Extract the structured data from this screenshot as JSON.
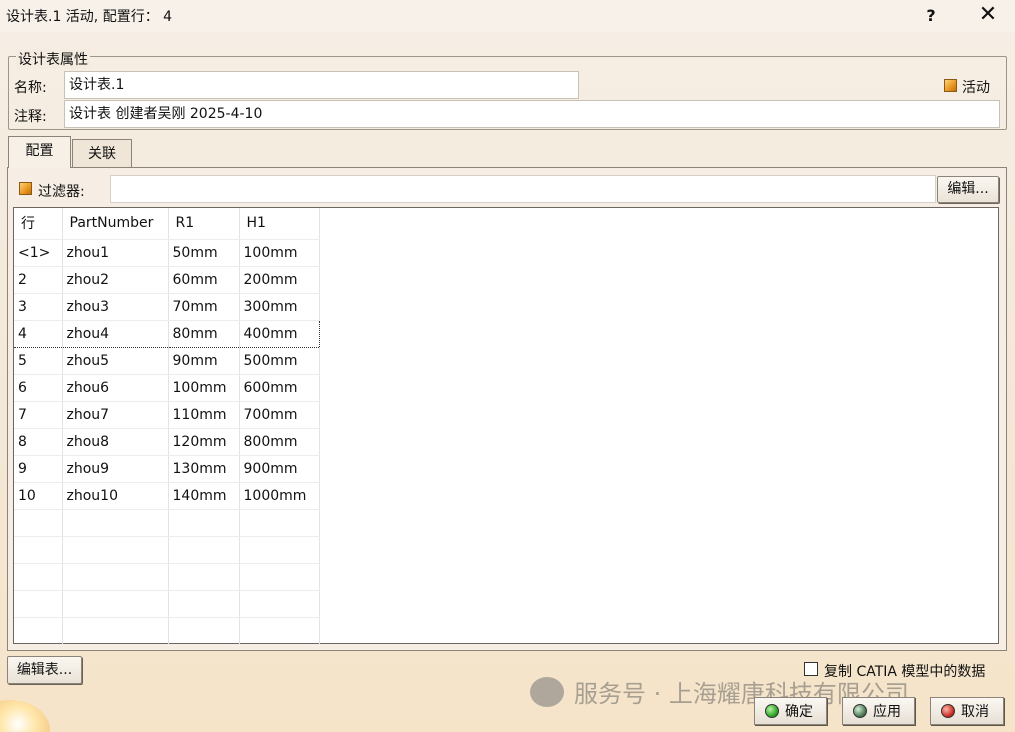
{
  "window": {
    "title": "设计表.1 活动, 配置行： 4",
    "help_label": "?",
    "close_label": "✕"
  },
  "properties": {
    "legend": "设计表属性",
    "name_label": "名称:",
    "name_value": "设计表.1",
    "comment_label": "注释:",
    "comment_value": "设计表 创建者吴刚 2025-4-10",
    "active_label": "活动"
  },
  "tabs": [
    {
      "label": "配置",
      "active": true
    },
    {
      "label": "关联",
      "active": false
    }
  ],
  "filter": {
    "label": "过滤器:",
    "value": "",
    "edit_label": "编辑..."
  },
  "table": {
    "columns": [
      "行",
      "PartNumber",
      "R1",
      "H1"
    ],
    "rows": [
      [
        "<1>",
        "zhou1",
        "50mm",
        "100mm"
      ],
      [
        "2",
        "zhou2",
        "60mm",
        "200mm"
      ],
      [
        "3",
        "zhou3",
        "70mm",
        "300mm"
      ],
      [
        "4",
        "zhou4",
        "80mm",
        "400mm"
      ],
      [
        "5",
        "zhou5",
        "90mm",
        "500mm"
      ],
      [
        "6",
        "zhou6",
        "100mm",
        "600mm"
      ],
      [
        "7",
        "zhou7",
        "110mm",
        "700mm"
      ],
      [
        "8",
        "zhou8",
        "120mm",
        "800mm"
      ],
      [
        "9",
        "zhou9",
        "130mm",
        "900mm"
      ],
      [
        "10",
        "zhou10",
        "140mm",
        "1000mm"
      ]
    ],
    "current_row": 4
  },
  "footer": {
    "edit_table_label": "编辑表...",
    "copy_label": "复制 CATIA 模型中的数据",
    "ok_label": "确定",
    "apply_label": "应用",
    "cancel_label": "取消"
  },
  "watermark": {
    "text": "服务号 · 上海耀唐科技有限公司"
  },
  "colors": {
    "active_check": "#e8961e",
    "ok": "#1f9b1a",
    "cancel": "#c2241a"
  }
}
